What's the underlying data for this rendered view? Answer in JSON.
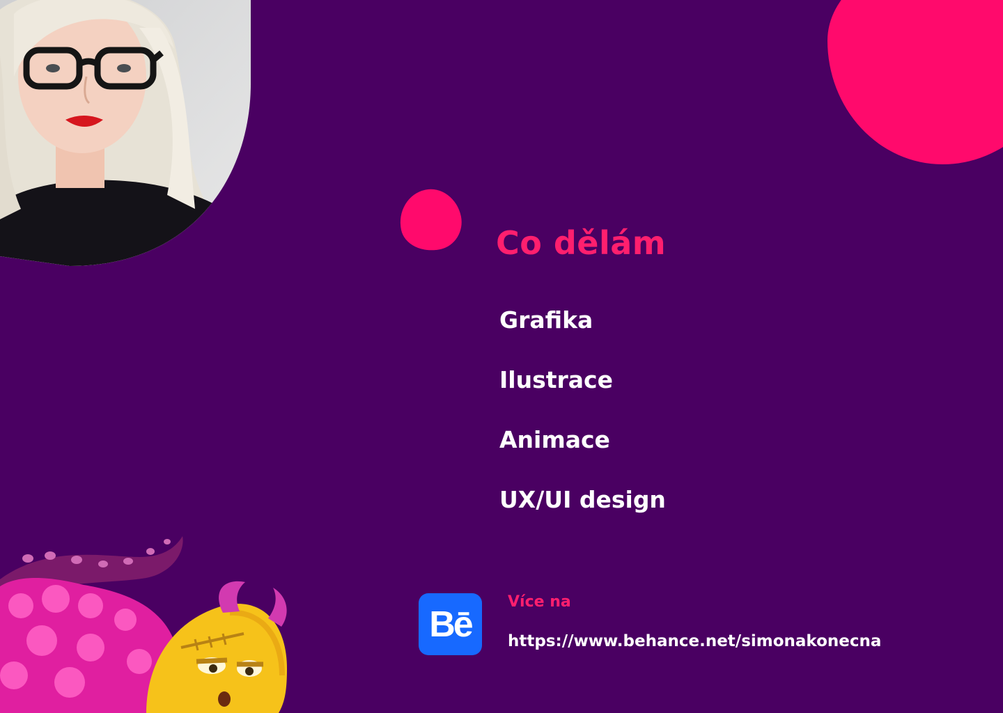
{
  "colors": {
    "background": "#4a0062",
    "accent": "#ff0a6c",
    "text": "#ffffff",
    "behance": "#1769ff"
  },
  "hero": {
    "portrait": "portrait-photo",
    "decorations": [
      "pink-blob",
      "pink-blob"
    ]
  },
  "services": {
    "heading": "Co dělám",
    "items": [
      "Grafika",
      "Ilustrace",
      "Animace",
      "UX/UI design"
    ]
  },
  "behance": {
    "icon": "behance-icon",
    "glyph": "Bē",
    "label": "Více na",
    "url": "https://www.behance.net/simonakonecna"
  },
  "illustration": "monster-illustration"
}
